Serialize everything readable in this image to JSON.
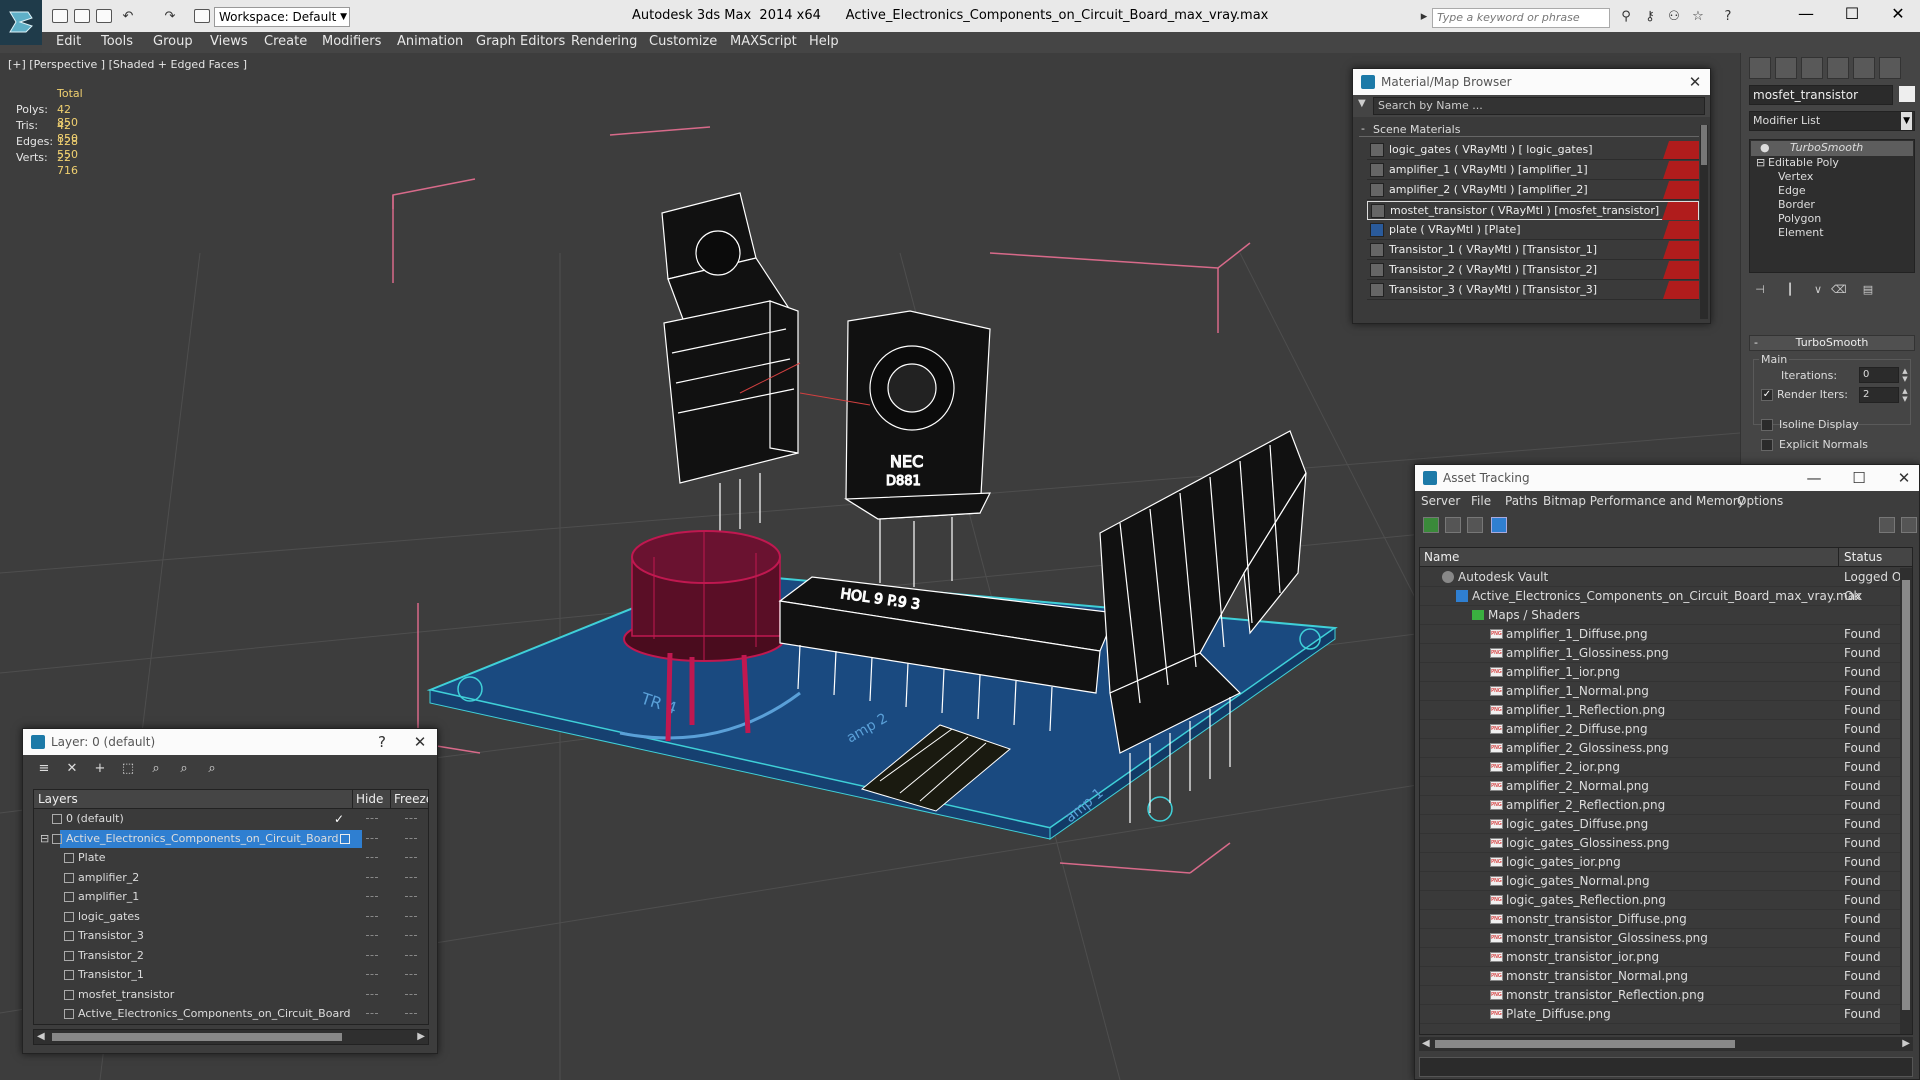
{
  "titlebar": {
    "workspace": "Workspace: Default",
    "title": "Autodesk 3ds Max  2014 x64      Active_Electronics_Components_on_Circuit_Board_max_vray.max",
    "search_placeholder": "Type a keyword or phrase",
    "minimize": "—",
    "maximize": "☐",
    "close": "✕"
  },
  "menu": [
    "Edit",
    "Tools",
    "Group",
    "Views",
    "Create",
    "Modifiers",
    "Animation",
    "Graph Editors",
    "Rendering",
    "Customize",
    "MAXScript",
    "Help"
  ],
  "viewport": {
    "label": "[+] [Perspective ] [Shaded + Edged Faces ]",
    "stats_header": "Total",
    "stats": [
      {
        "label": "Polys:",
        "value": "42 850"
      },
      {
        "label": "Tris:",
        "value": "42 850"
      },
      {
        "label": "Edges:",
        "value": "128 550"
      },
      {
        "label": "Verts:",
        "value": "22 716"
      }
    ],
    "colors": {
      "background": "#3d3d3d",
      "board": "#1a4a80",
      "wire": "#ffffff",
      "accent": "#c01850",
      "selection_box": "#d86a8a",
      "grid": "#555555"
    }
  },
  "command_panel": {
    "object_name": "mosfet_transistor",
    "modifier_list": "Modifier List",
    "stack": [
      "TurboSmooth",
      "Editable Poly",
      "Vertex",
      "Edge",
      "Border",
      "Polygon",
      "Element"
    ],
    "rollout_title": "TurboSmooth",
    "main_label": "Main",
    "iterations_label": "Iterations:",
    "iterations_value": "0",
    "render_iters_label": "Render Iters:",
    "render_iters_value": "2",
    "isoline_label": "Isoline Display",
    "explicit_normals_label": "Explicit Normals"
  },
  "material_browser": {
    "title": "Material/Map Browser",
    "search_placeholder": "Search by Name ...",
    "group": "Scene Materials",
    "materials": [
      " logic_gates  ( VRayMtl ) [ logic_gates]",
      "amplifier_1  ( VRayMtl ) [amplifier_1]",
      "amplifier_2  ( VRayMtl ) [amplifier_2]",
      "mostet_transistor  ( VRayMtl ) [mosfet_transistor]",
      "plate  ( VRayMtl ) [Plate]",
      "Transistor_1  ( VRayMtl ) [Transistor_1]",
      "Transistor_2  ( VRayMtl ) [Transistor_2]",
      "Transistor_3  ( VRayMtl ) [Transistor_3]"
    ],
    "selected_index": 3
  },
  "asset_tracking": {
    "title": "Asset Tracking",
    "menu": [
      "Server",
      "File",
      "Paths",
      "Bitmap Performance and Memory",
      "Options"
    ],
    "col_name": "Name",
    "col_status": "Status",
    "rows": [
      {
        "name": "Autodesk Vault",
        "status": "Logged Ou",
        "level": 1,
        "icon": "vault"
      },
      {
        "name": "Active_Electronics_Components_on_Circuit_Board_max_vray.max",
        "status": "Ok",
        "level": 2,
        "icon": "max"
      },
      {
        "name": "Maps / Shaders",
        "status": "",
        "level": 3,
        "icon": "folder"
      },
      {
        "name": "amplifier_1_Diffuse.png",
        "status": "Found",
        "level": 4,
        "icon": "png"
      },
      {
        "name": "amplifier_1_Glossiness.png",
        "status": "Found",
        "level": 4,
        "icon": "png"
      },
      {
        "name": "amplifier_1_ior.png",
        "status": "Found",
        "level": 4,
        "icon": "png"
      },
      {
        "name": "amplifier_1_Normal.png",
        "status": "Found",
        "level": 4,
        "icon": "png"
      },
      {
        "name": "amplifier_1_Reflection.png",
        "status": "Found",
        "level": 4,
        "icon": "png"
      },
      {
        "name": "amplifier_2_Diffuse.png",
        "status": "Found",
        "level": 4,
        "icon": "png"
      },
      {
        "name": "amplifier_2_Glossiness.png",
        "status": "Found",
        "level": 4,
        "icon": "png"
      },
      {
        "name": "amplifier_2_ior.png",
        "status": "Found",
        "level": 4,
        "icon": "png"
      },
      {
        "name": "amplifier_2_Normal.png",
        "status": "Found",
        "level": 4,
        "icon": "png"
      },
      {
        "name": "amplifier_2_Reflection.png",
        "status": "Found",
        "level": 4,
        "icon": "png"
      },
      {
        "name": "logic_gates_Diffuse.png",
        "status": "Found",
        "level": 4,
        "icon": "png"
      },
      {
        "name": "logic_gates_Glossiness.png",
        "status": "Found",
        "level": 4,
        "icon": "png"
      },
      {
        "name": "logic_gates_ior.png",
        "status": "Found",
        "level": 4,
        "icon": "png"
      },
      {
        "name": "logic_gates_Normal.png",
        "status": "Found",
        "level": 4,
        "icon": "png"
      },
      {
        "name": "logic_gates_Reflection.png",
        "status": "Found",
        "level": 4,
        "icon": "png"
      },
      {
        "name": "monstr_transistor_Diffuse.png",
        "status": "Found",
        "level": 4,
        "icon": "png"
      },
      {
        "name": "monstr_transistor_Glossiness.png",
        "status": "Found",
        "level": 4,
        "icon": "png"
      },
      {
        "name": "monstr_transistor_ior.png",
        "status": "Found",
        "level": 4,
        "icon": "png"
      },
      {
        "name": "monstr_transistor_Normal.png",
        "status": "Found",
        "level": 4,
        "icon": "png"
      },
      {
        "name": "monstr_transistor_Reflection.png",
        "status": "Found",
        "level": 4,
        "icon": "png"
      },
      {
        "name": "Plate_Diffuse.png",
        "status": "Found",
        "level": 4,
        "icon": "png"
      }
    ]
  },
  "layer_dialog": {
    "title": "Layer: 0 (default)",
    "help": "?",
    "close": "✕",
    "col_layers": "Layers",
    "col_hide": "Hide",
    "col_freeze": "Freeze",
    "rows": [
      {
        "name": "0 (default)",
        "level": 1,
        "checked": true,
        "selected": false
      },
      {
        "name": "Active_Electronics_Components_on_Circuit_Board",
        "level": 1,
        "checked": false,
        "selected": true
      },
      {
        "name": "Plate",
        "level": 2,
        "checked": false,
        "selected": false
      },
      {
        "name": "amplifier_2",
        "level": 2,
        "checked": false,
        "selected": false
      },
      {
        "name": "amplifier_1",
        "level": 2,
        "checked": false,
        "selected": false
      },
      {
        "name": "logic_gates",
        "level": 2,
        "checked": false,
        "selected": false
      },
      {
        "name": "Transistor_3",
        "level": 2,
        "checked": false,
        "selected": false
      },
      {
        "name": "Transistor_2",
        "level": 2,
        "checked": false,
        "selected": false
      },
      {
        "name": "Transistor_1",
        "level": 2,
        "checked": false,
        "selected": false
      },
      {
        "name": "mosfet_transistor",
        "level": 2,
        "checked": false,
        "selected": false
      },
      {
        "name": "Active_Electronics_Components_on_Circuit_Board",
        "level": 2,
        "checked": false,
        "selected": false
      }
    ]
  }
}
